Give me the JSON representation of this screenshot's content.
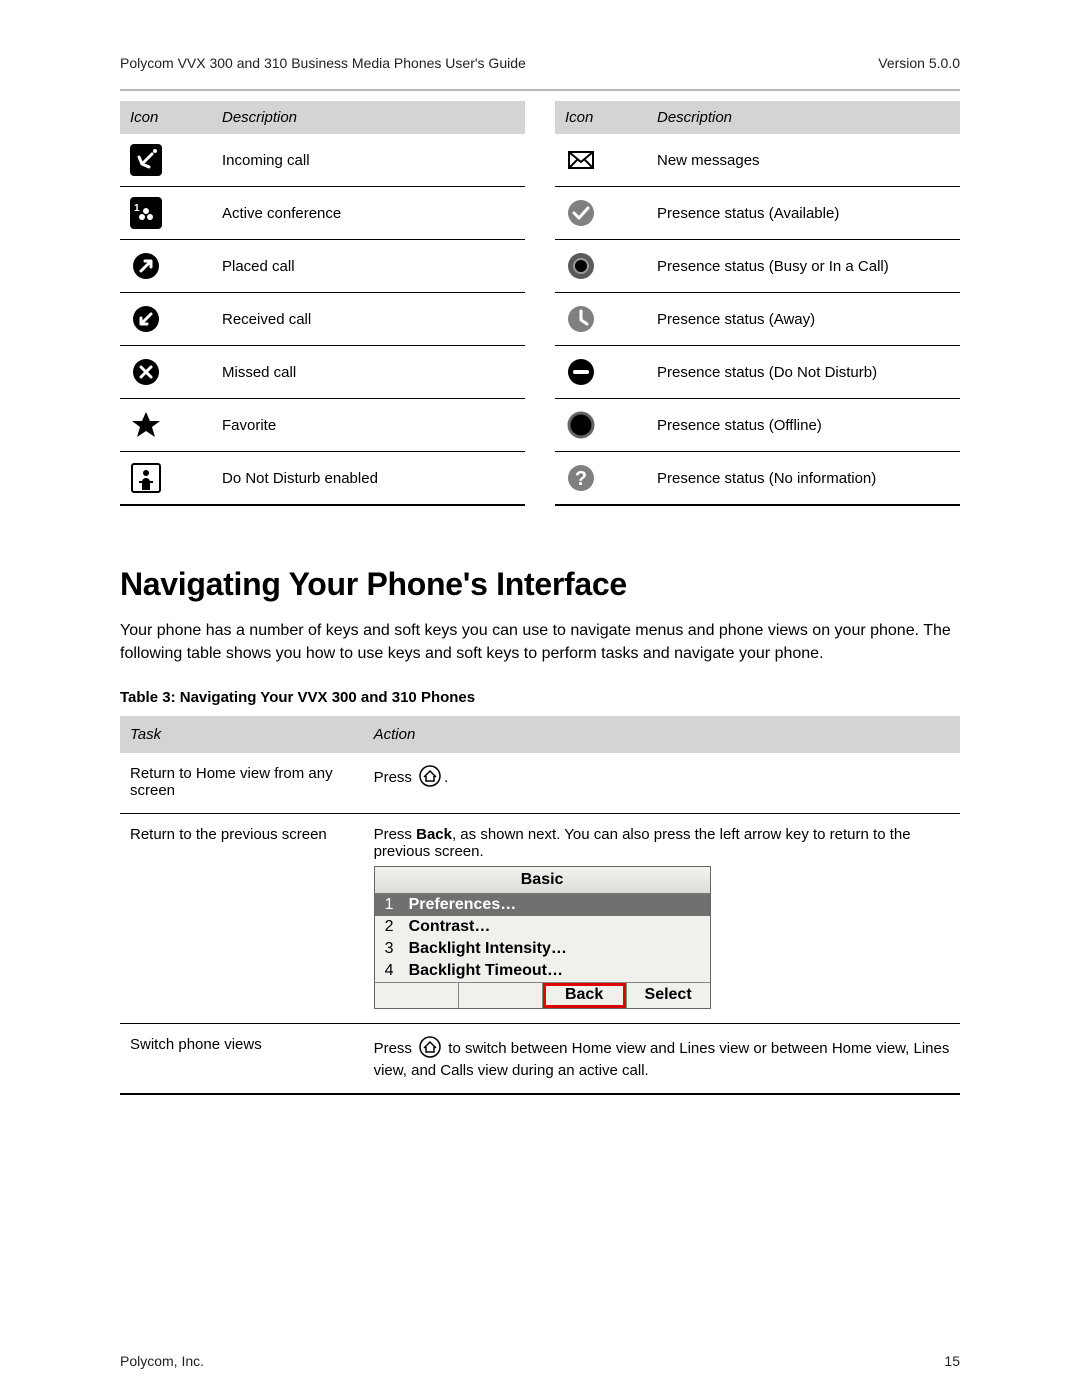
{
  "header": {
    "left": "Polycom VVX 300 and 310 Business Media Phones User's Guide",
    "right": "Version 5.0.0"
  },
  "footer": {
    "left": "Polycom, Inc.",
    "right": "15"
  },
  "icon_table_left": {
    "col1": "Icon",
    "col2": "Description",
    "rows": [
      {
        "desc": "Incoming call"
      },
      {
        "desc": "Active conference"
      },
      {
        "desc": "Placed call"
      },
      {
        "desc": "Received call"
      },
      {
        "desc": "Missed call"
      },
      {
        "desc": "Favorite"
      },
      {
        "desc": "Do Not Disturb enabled"
      }
    ]
  },
  "icon_table_right": {
    "col1": "Icon",
    "col2": "Description",
    "rows": [
      {
        "desc": "New messages"
      },
      {
        "desc": "Presence status (Available)"
      },
      {
        "desc": "Presence status (Busy or In a Call)"
      },
      {
        "desc": "Presence status (Away)"
      },
      {
        "desc": "Presence status (Do Not Disturb)"
      },
      {
        "desc": "Presence status (Offline)"
      },
      {
        "desc": "Presence status (No information)"
      }
    ]
  },
  "heading": "Navigating Your Phone's Interface",
  "intro": "Your phone has a number of keys and soft keys you can use to navigate menus and phone views on your phone. The following table shows you how to use keys and soft keys to perform tasks and navigate your phone.",
  "table_caption": "Table 3: Navigating Your VVX 300 and 310 Phones",
  "task_table": {
    "col1": "Task",
    "col2": "Action",
    "rows": [
      {
        "task": "Return to Home view from any screen",
        "action_before": "Press ",
        "action_after": "."
      },
      {
        "task": "Return to the previous screen",
        "action_before": "Press ",
        "action_bold": "Back",
        "action_after": ", as shown next. You can also press the left arrow key to return to the previous screen."
      },
      {
        "task": "Switch phone views",
        "action_before": "Press ",
        "action_after": " to switch between Home view and Lines view or between Home view, Lines view, and Calls view during an active call."
      }
    ]
  },
  "phone_mock": {
    "title": "Basic",
    "items": [
      {
        "num": "1",
        "label": "Preferences…",
        "selected": true
      },
      {
        "num": "2",
        "label": "Contrast…",
        "selected": false
      },
      {
        "num": "3",
        "label": "Backlight Intensity…",
        "selected": false
      },
      {
        "num": "4",
        "label": "Backlight Timeout…",
        "selected": false
      }
    ],
    "softkeys": {
      "blank1": "",
      "blank2": "",
      "back": "Back",
      "select": "Select"
    }
  }
}
